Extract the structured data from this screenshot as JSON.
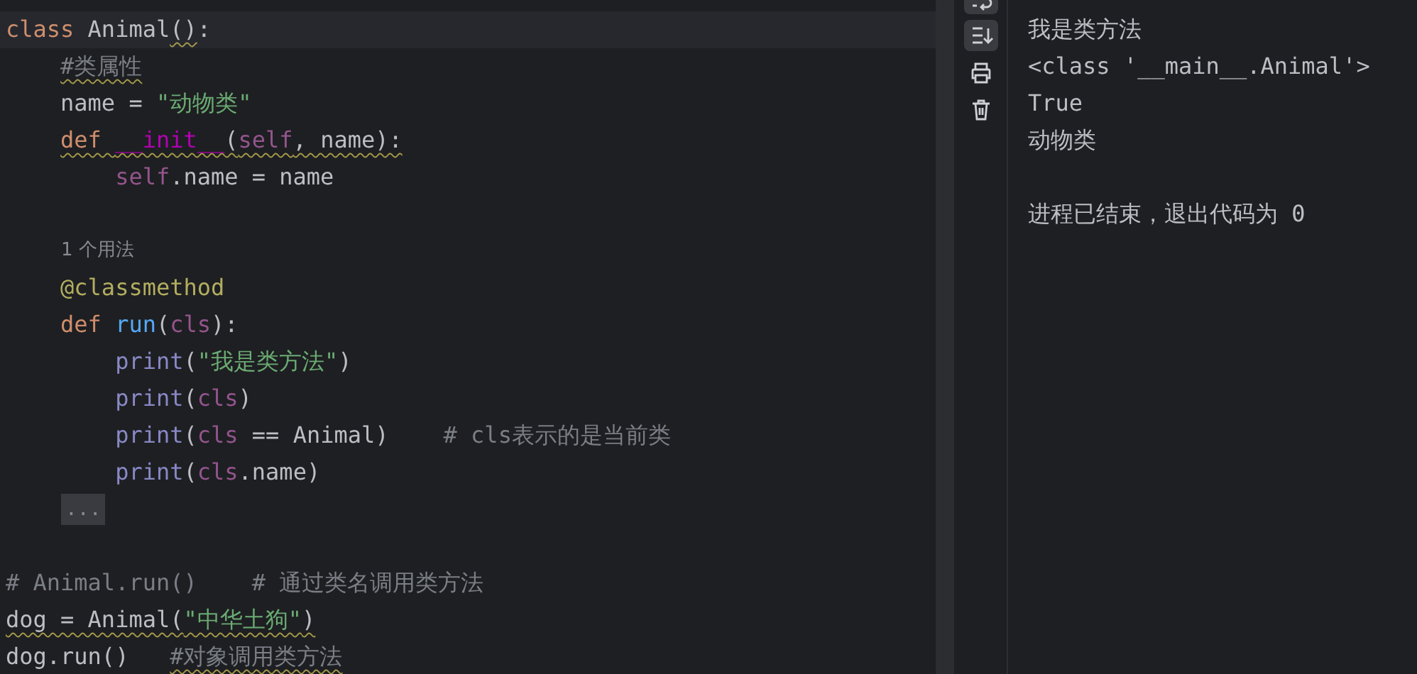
{
  "editor": {
    "lines": [
      {
        "kind": "code",
        "current": true,
        "tokens": [
          {
            "kind": "keyword",
            "text": "class ",
            "warning": false
          },
          {
            "kind": "plain",
            "text": "Animal",
            "warning": false
          },
          {
            "kind": "plain",
            "text": "()",
            "warning": true
          },
          {
            "kind": "plain",
            "text": ":",
            "warning": false
          }
        ]
      },
      {
        "kind": "code",
        "current": false,
        "tokens": [
          {
            "kind": "comment",
            "text": "    #类属性",
            "warning": true
          }
        ]
      },
      {
        "kind": "code",
        "current": false,
        "tokens": [
          {
            "kind": "plain",
            "text": "    name = ",
            "warning": false
          },
          {
            "kind": "string",
            "text": "\"动物类\"",
            "warning": false
          }
        ]
      },
      {
        "kind": "code",
        "current": false,
        "tokens": [
          {
            "kind": "keyword",
            "text": "    def ",
            "warning": true
          },
          {
            "kind": "magic",
            "text": "__init__",
            "warning": true
          },
          {
            "kind": "plain",
            "text": "(",
            "warning": true
          },
          {
            "kind": "self",
            "text": "self",
            "warning": true
          },
          {
            "kind": "plain",
            "text": ", name):",
            "warning": true
          }
        ]
      },
      {
        "kind": "code",
        "current": false,
        "tokens": [
          {
            "kind": "self",
            "text": "        self",
            "warning": false
          },
          {
            "kind": "plain",
            "text": ".name = name",
            "warning": false
          }
        ]
      },
      {
        "kind": "blank",
        "current": false
      },
      {
        "kind": "hint",
        "current": false,
        "text": "1 个用法"
      },
      {
        "kind": "code",
        "current": false,
        "tokens": [
          {
            "kind": "decorator",
            "text": "    @classmethod",
            "warning": false
          }
        ]
      },
      {
        "kind": "code",
        "current": false,
        "tokens": [
          {
            "kind": "keyword",
            "text": "    def ",
            "warning": false
          },
          {
            "kind": "function",
            "text": "run",
            "warning": false
          },
          {
            "kind": "plain",
            "text": "(",
            "warning": false
          },
          {
            "kind": "self",
            "text": "cls",
            "warning": false
          },
          {
            "kind": "plain",
            "text": "):",
            "warning": false
          }
        ]
      },
      {
        "kind": "code",
        "current": false,
        "tokens": [
          {
            "kind": "builtin",
            "text": "        print",
            "warning": false
          },
          {
            "kind": "plain",
            "text": "(",
            "warning": false
          },
          {
            "kind": "string",
            "text": "\"我是类方法\"",
            "warning": false
          },
          {
            "kind": "plain",
            "text": ")",
            "warning": false
          }
        ]
      },
      {
        "kind": "code",
        "current": false,
        "tokens": [
          {
            "kind": "builtin",
            "text": "        print",
            "warning": false
          },
          {
            "kind": "plain",
            "text": "(",
            "warning": false
          },
          {
            "kind": "self",
            "text": "cls",
            "warning": false
          },
          {
            "kind": "plain",
            "text": ")",
            "warning": false
          }
        ]
      },
      {
        "kind": "code",
        "current": false,
        "tokens": [
          {
            "kind": "builtin",
            "text": "        print",
            "warning": false
          },
          {
            "kind": "plain",
            "text": "(",
            "warning": false
          },
          {
            "kind": "self",
            "text": "cls",
            "warning": false
          },
          {
            "kind": "plain",
            "text": " == Animal)    ",
            "warning": false
          },
          {
            "kind": "comment",
            "text": "# cls表示的是当前类",
            "warning": false
          }
        ]
      },
      {
        "kind": "code",
        "current": false,
        "tokens": [
          {
            "kind": "builtin",
            "text": "        print",
            "warning": false
          },
          {
            "kind": "plain",
            "text": "(",
            "warning": false
          },
          {
            "kind": "self",
            "text": "cls",
            "warning": false
          },
          {
            "kind": "plain",
            "text": ".name)",
            "warning": false
          }
        ]
      },
      {
        "kind": "fold",
        "current": false,
        "text": "..."
      },
      {
        "kind": "blank",
        "current": false
      },
      {
        "kind": "code",
        "current": false,
        "tokens": [
          {
            "kind": "comment",
            "text": "# Animal.run()    # 通过类名调用类方法",
            "warning": false
          }
        ]
      },
      {
        "kind": "code",
        "current": false,
        "tokens": [
          {
            "kind": "plain",
            "text": "dog = Animal(",
            "warning": true
          },
          {
            "kind": "string",
            "text": "\"中华土狗\"",
            "warning": true
          },
          {
            "kind": "plain",
            "text": ")",
            "warning": true
          }
        ]
      },
      {
        "kind": "code",
        "current": false,
        "tokens": [
          {
            "kind": "plain",
            "text": "dog.run()   ",
            "warning": false
          },
          {
            "kind": "comment",
            "text": "#对象调用类方法",
            "warning": true
          }
        ]
      }
    ]
  },
  "tools": [
    {
      "kind": "wrap",
      "on": true
    },
    {
      "kind": "scroll-end",
      "on": true
    },
    {
      "kind": "print",
      "on": false
    },
    {
      "kind": "trash",
      "on": false
    }
  ],
  "output": {
    "lines": [
      {
        "kind": "text",
        "text": "我是类方法"
      },
      {
        "kind": "text",
        "text": "<class '__main__.Animal'>"
      },
      {
        "kind": "text",
        "text": "True"
      },
      {
        "kind": "text",
        "text": "动物类"
      },
      {
        "kind": "blank"
      },
      {
        "kind": "text",
        "text": "进程已结束，退出代码为 0"
      }
    ]
  }
}
